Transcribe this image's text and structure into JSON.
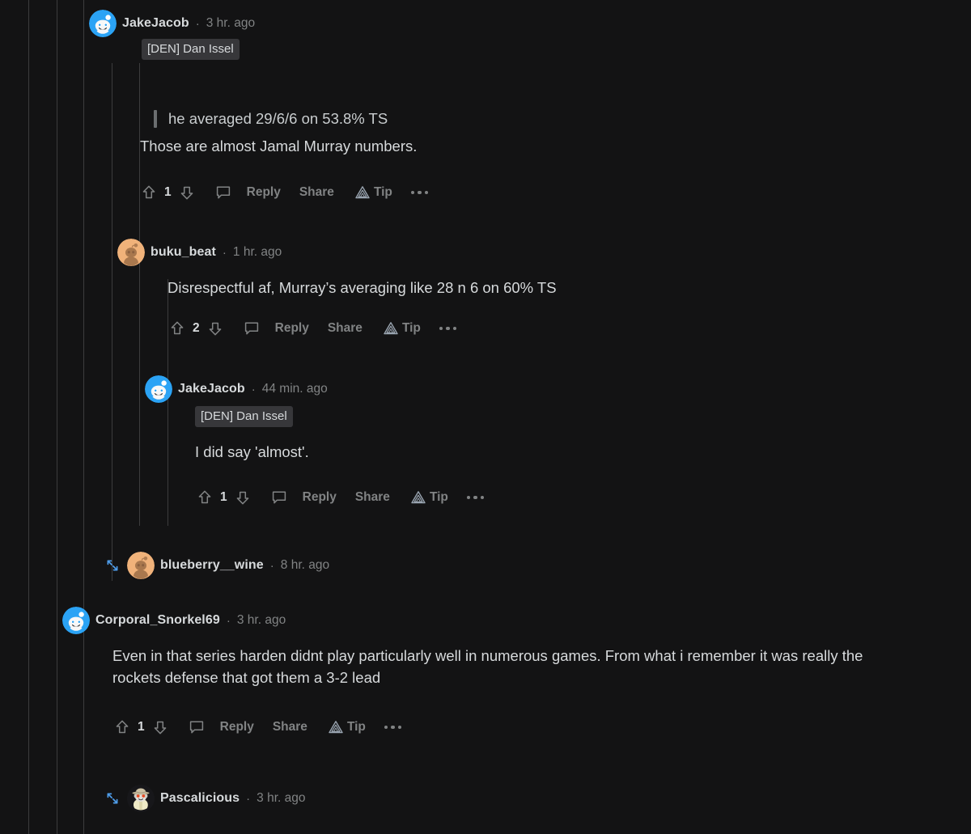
{
  "theme": {
    "background": "#131314",
    "text_primary": "#d7dadc",
    "text_muted": "#818384",
    "rail_line": "#3c3c3d",
    "flair_bg": "#37373a",
    "expand_icon": "#4f9eec",
    "quote_bar": "#6b6e70"
  },
  "labels": {
    "reply": "Reply",
    "share": "Share",
    "tip": "Tip",
    "separator": "·"
  },
  "icons": {
    "upvote": "upvote-arrow-icon",
    "downvote": "downvote-arrow-icon",
    "comment": "comment-bubble-icon",
    "tip": "tip-triangle-icon",
    "overflow": "overflow-menu-icon",
    "expand": "expand-arrows-icon"
  },
  "comments": [
    {
      "id": "c1",
      "username": "JakeJacob",
      "timestamp": "3 hr. ago",
      "flair": "[DEN] Dan Issel",
      "quote": "he averaged 29/6/6 on 53.8% TS",
      "body": "Those are almost Jamal Murray numbers.",
      "votes": "1",
      "avatar": "snoo-blue-helmet"
    },
    {
      "id": "c2",
      "username": "buku_beat",
      "timestamp": "1 hr. ago",
      "flair": null,
      "quote": null,
      "body": "Disrespectful af, Murray’s averaging like 28 n 6 on 60% TS",
      "votes": "2",
      "avatar": "snoo-orange-silhouette"
    },
    {
      "id": "c3",
      "username": "JakeJacob",
      "timestamp": "44 min. ago",
      "flair": "[DEN] Dan Issel",
      "quote": null,
      "body": "I did say 'almost'.",
      "votes": "1",
      "avatar": "snoo-blue-helmet"
    },
    {
      "id": "c4",
      "username": "blueberry__wine",
      "timestamp": "8 hr. ago",
      "flair": null,
      "quote": null,
      "body": null,
      "votes": null,
      "collapsed": true,
      "avatar": "snoo-orange-silhouette"
    },
    {
      "id": "c5",
      "username": "Corporal_Snorkel69",
      "timestamp": "3 hr. ago",
      "flair": null,
      "quote": null,
      "body": "Even in that series harden didnt play particularly well in numerous games. From what i remember it was really the rockets defense that got them a 3-2 lead",
      "votes": "1",
      "avatar": "snoo-blue-helmet"
    },
    {
      "id": "c6",
      "username": "Pascalicious",
      "timestamp": "3 hr. ago",
      "flair": null,
      "quote": null,
      "body": null,
      "votes": null,
      "collapsed": true,
      "avatar": "snoo-fedora-hat"
    }
  ]
}
